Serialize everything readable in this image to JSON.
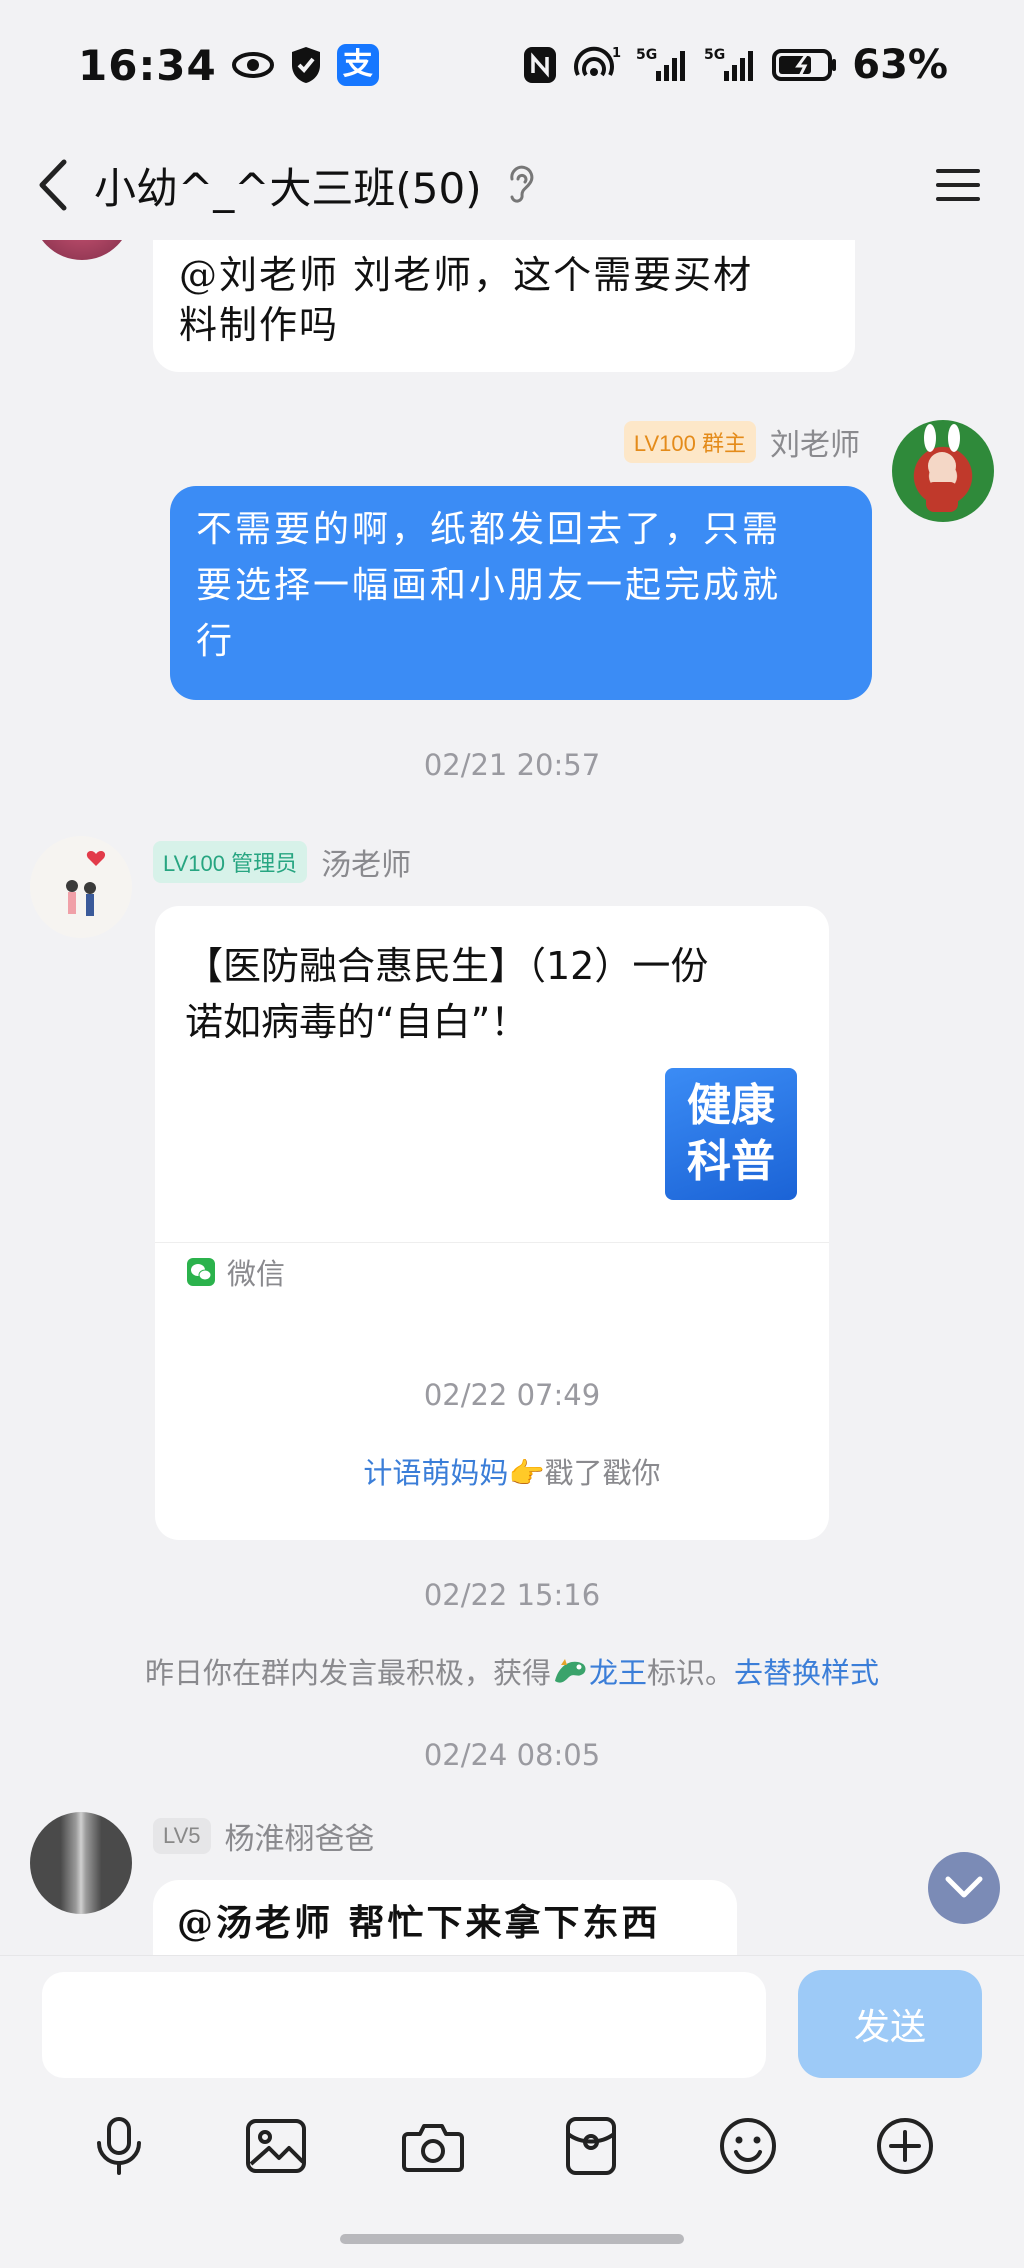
{
  "status_bar": {
    "time": "16:34",
    "alipay_glyph": "支",
    "battery_percent": "63%",
    "icons": [
      "eye-icon",
      "shield-icon",
      "alipay-icon",
      "nfc-icon",
      "hotspot-icon",
      "signal-5g-icon",
      "signal-5g-icon",
      "battery-icon"
    ]
  },
  "header": {
    "title": "小幼^_^大三班(50)",
    "icons": [
      "back-chevron-icon",
      "ear-icon",
      "menu-icon"
    ]
  },
  "messages": [
    {
      "type": "text",
      "side": "left",
      "text_lines": [
        "@刘老师 刘老师，这个需要买材",
        "料制作吗"
      ]
    },
    {
      "type": "text",
      "side": "right",
      "sender": "刘老师",
      "badge": "LV100 群主",
      "text_lines": [
        "不需要的啊，纸都发回去了，只需",
        "要选择一幅画和小朋友一起完成就",
        "行"
      ]
    },
    {
      "type": "timestamp",
      "text": "02/21 20:57"
    },
    {
      "type": "share",
      "side": "left",
      "sender": "汤老师",
      "badge": "LV100 管理员",
      "title_lines": [
        "【医防融合惠民生】（12）一份",
        "诺如病毒的“自白”！"
      ],
      "thumb_lines": [
        "健康",
        "科普"
      ],
      "source": "微信"
    },
    {
      "type": "timestamp",
      "text": "02/22 07:49"
    },
    {
      "type": "system",
      "name": "计语萌妈妈",
      "emoji": "👉",
      "action": "戳了戳你"
    },
    {
      "type": "timestamp",
      "text": "02/22 15:16"
    },
    {
      "type": "system",
      "prefix": "昨日你在群内发言最积极，获得",
      "title": "龙王",
      "suffix": "标识。",
      "link": "去替换样式"
    },
    {
      "type": "timestamp",
      "text": "02/24 08:05"
    },
    {
      "type": "text",
      "side": "left",
      "sender": "杨淮栩爸爸",
      "badge": "LV5",
      "text_lines": [
        "@汤老师 帮忙下来拿下东西"
      ]
    }
  ],
  "composer": {
    "input_value": "",
    "send_label": "发送",
    "tools": [
      "microphone-icon",
      "image-icon",
      "camera-icon",
      "red-packet-icon",
      "emoji-icon",
      "plus-icon"
    ]
  },
  "colors": {
    "accent": "#3b8cf5",
    "link": "#3b7ed8",
    "owner_badge": "#e48b1a",
    "admin_badge": "#27a581"
  }
}
